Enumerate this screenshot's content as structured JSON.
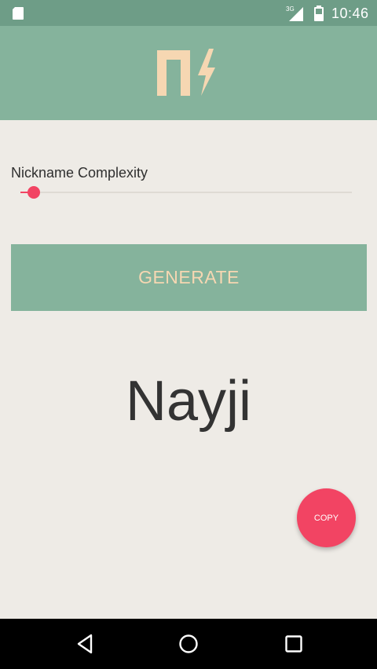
{
  "status_bar": {
    "network_type": "3G",
    "time": "10:46"
  },
  "header": {
    "logo_icon": "lightning-n-logo",
    "logo_color": "#f6d7b2",
    "background": "#85b39c"
  },
  "complexity": {
    "label": "Nickname Complexity",
    "value_fraction": 0.02,
    "accent": "#f24463"
  },
  "generate_button": {
    "label": "GENERATE"
  },
  "result": {
    "nickname": "Nayji"
  },
  "copy_button": {
    "label": "COPY"
  },
  "navigation": {
    "icons": [
      "back-icon",
      "home-icon",
      "recents-icon"
    ]
  }
}
